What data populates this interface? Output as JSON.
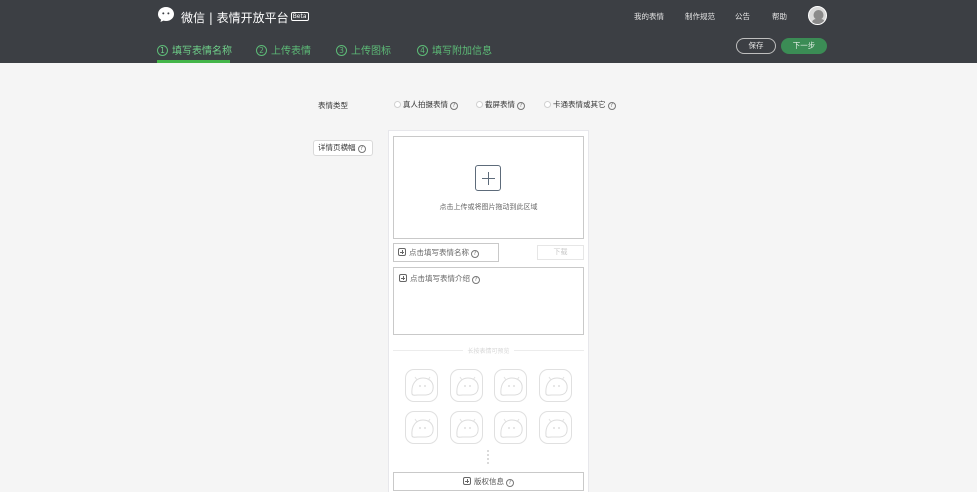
{
  "header": {
    "brand": "微信 | 表情开放平台",
    "beta": "Beta",
    "nav": [
      "我的表情",
      "制作规范",
      "公告",
      "帮助"
    ]
  },
  "steps": [
    {
      "num": "1",
      "label": "填写表情名称"
    },
    {
      "num": "2",
      "label": "上传表情"
    },
    {
      "num": "3",
      "label": "上传图标"
    },
    {
      "num": "4",
      "label": "填写附加信息"
    }
  ],
  "actions": {
    "save": "保存",
    "next": "下一步"
  },
  "form": {
    "type_label": "表情类型",
    "types": [
      "真人拍摄表情",
      "截屏表情",
      "卡通表情或其它"
    ],
    "help": "?"
  },
  "banner_button": "详情页横幅",
  "upload": {
    "hint": "点击上传或将图片拖动到此区域"
  },
  "name_input": {
    "placeholder": "点击填写表情名称"
  },
  "download": "下载",
  "intro": {
    "placeholder": "点击填写表情介绍"
  },
  "divider": "长按表情可预览",
  "copyright": "版权信息",
  "colors": {
    "header_bg": "#3c3f44",
    "accent": "#44b549"
  }
}
